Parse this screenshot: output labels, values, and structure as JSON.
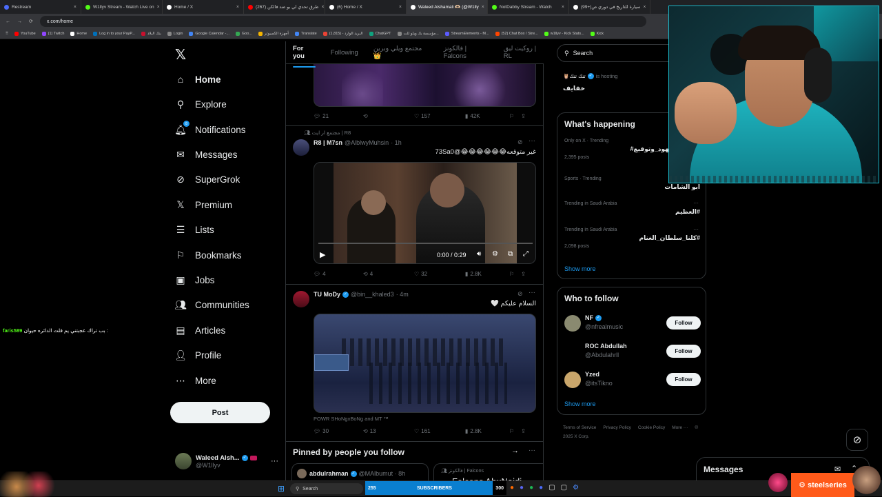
{
  "browser": {
    "tabs": [
      {
        "title": "Restream",
        "color": "#4b6bfb"
      },
      {
        "title": "W1llyv Stream - Watch Live on",
        "color": "#53fc18"
      },
      {
        "title": "Home / X",
        "color": "#ffffff"
      },
      {
        "title": "(267) طرق تحدي لي بو ضد فالكن",
        "color": "#ff0000"
      },
      {
        "title": "(6) Home / X",
        "color": "#ffffff"
      },
      {
        "title": "Waleed Alshamali 🫶🏻 (@W1lly",
        "color": "#ffffff"
      },
      {
        "title": "NotDabby Stream - Watch",
        "color": "#53fc18"
      },
      {
        "title": "(99+)سيارة للتاريخ في دوري ص",
        "color": "#ffffff"
      }
    ],
    "url": "x.com/home",
    "bookmarks": [
      {
        "label": "YouTube",
        "color": "#ff0000"
      },
      {
        "label": "(1) Twitch",
        "color": "#9146ff"
      },
      {
        "label": "Home",
        "color": "#ffffff"
      },
      {
        "label": "Log in to your PayP...",
        "color": "#0070ba"
      },
      {
        "label": "بنك البلاد",
        "color": "#c8102e"
      },
      {
        "label": "Login",
        "color": "#888888"
      },
      {
        "label": "Google Calendar -...",
        "color": "#4285f4"
      },
      {
        "label": "Goo...",
        "color": "#34a853"
      },
      {
        "label": "أجهزة الكمبيوتر",
        "color": "#f4b400"
      },
      {
        "label": "Translate",
        "color": "#4285f4"
      },
      {
        "label": "البريد الوارد - (1,815)",
        "color": "#ea4335"
      },
      {
        "label": "ChatGPT",
        "color": "#10a37f"
      },
      {
        "label": "مؤسسة بك ويلو للت...",
        "color": "#888888"
      },
      {
        "label": "StreamElements - M...",
        "color": "#5b5bff"
      },
      {
        "label": "(52) Chat Box / Stre...",
        "color": "#ff4500"
      },
      {
        "label": "w1llyv - Kick Stats...",
        "color": "#53fc18"
      },
      {
        "label": "Kick",
        "color": "#53fc18"
      }
    ]
  },
  "nav": {
    "items": [
      {
        "label": "Home",
        "icon": "home-icon",
        "glyph": "⌂"
      },
      {
        "label": "Explore",
        "icon": "search-icon",
        "glyph": "⚲"
      },
      {
        "label": "Notifications",
        "icon": "bell-icon",
        "glyph": "🔔︎",
        "badge": "8"
      },
      {
        "label": "Messages",
        "icon": "envelope-icon",
        "glyph": "✉"
      },
      {
        "label": "SuperGrok",
        "icon": "grok-icon",
        "glyph": "⊘"
      },
      {
        "label": "Premium",
        "icon": "x-logo-icon",
        "glyph": "𝕏"
      },
      {
        "label": "Lists",
        "icon": "list-icon",
        "glyph": "☰"
      },
      {
        "label": "Bookmarks",
        "icon": "bookmark-icon",
        "glyph": "⚐"
      },
      {
        "label": "Jobs",
        "icon": "briefcase-icon",
        "glyph": "▣"
      },
      {
        "label": "Communities",
        "icon": "people-icon",
        "glyph": "👥︎"
      },
      {
        "label": "Articles",
        "icon": "document-icon",
        "glyph": "▤"
      },
      {
        "label": "Profile",
        "icon": "person-icon",
        "glyph": "👤︎"
      },
      {
        "label": "More",
        "icon": "more-circle-icon",
        "glyph": "⋯"
      }
    ],
    "post_label": "Post",
    "account_name": "Waleed Alsh...",
    "account_handle": "@W1llyv"
  },
  "feed": {
    "tabs": [
      "For you",
      "Following",
      "مجتمع ويلي وبرين 👑",
      "فالكونز | Falcons",
      "روكيت ليق | RL"
    ],
    "tweet0": {
      "replies": "21",
      "retweets": "",
      "likes": "157",
      "views": "42K"
    },
    "tweet1": {
      "context": "مجتمع ار ايت | R8",
      "name": "R8 | M7sn",
      "handle": "@AlblwyMuhsin",
      "time": "· 1h",
      "text": "غير متوقعه😂😂😂😂😂😂@73Sa0",
      "video_time": "0:00 / 0:29",
      "replies": "4",
      "retweets": "4",
      "likes": "32",
      "views": "2.8K"
    },
    "tweet2": {
      "name": "TU MoDy",
      "handle": "@bin__khaled3",
      "time": "· 4m",
      "text": "السلام عليكم 🤍",
      "caption": "POWR SHoNgxBoNg and MT ™",
      "replies": "30",
      "retweets": "13",
      "likes": "161",
      "views": "2.8K"
    },
    "pinned_title": "Pinned by people you follow",
    "pinned1_name": "abdulrahman",
    "pinned1_handle": "@MAlbumut · 8h",
    "pinned2_context": "فالكونز | Falcons",
    "pinned2_name": "Falcons AbuNaidi"
  },
  "right": {
    "search_placeholder": "Search",
    "spaces_host": "🦉تنك تنك",
    "spaces_hosting": "is hosting",
    "spaces_title": "خفايف",
    "whats_happening": "What's happening",
    "trends": [
      {
        "meta": "Only on X · Trending",
        "name": "محتاجه_شهود_وتوقيع#",
        "posts": "2,395 posts"
      },
      {
        "meta": "Sports · Trending",
        "name": "ابو الشامات",
        "posts": ""
      },
      {
        "meta": "Trending in Saudi Arabia",
        "name": "#العظيم",
        "posts": ""
      },
      {
        "meta": "Trending in Saudi Arabia",
        "name": "#كلنا_سلطان_الغنام",
        "posts": "2,098 posts"
      }
    ],
    "show_more": "Show more",
    "who_to_follow": "Who to follow",
    "follows": [
      {
        "name": "NF",
        "handle": "@nfrealmusic",
        "verified": true,
        "color": "#8a8a70"
      },
      {
        "name": "ROC Abdullah",
        "handle": "@Abdulahrll",
        "verified": false,
        "color": "#000000"
      },
      {
        "name": "Yzed",
        "handle": "@itsTikno",
        "verified": false,
        "color": "#c9a66b"
      }
    ],
    "follow_label": "Follow",
    "show_more_2": "Show more",
    "footer": [
      "Terms of Service",
      "Privacy Policy",
      "Cookie Policy",
      "More ···",
      "© 2025 X Corp."
    ],
    "messages_label": "Messages"
  },
  "overlay": {
    "chat_user": "faris589",
    "chat_text": "بب تراك عجبتني يم قلت الدائره حيوان :",
    "subs_count": "255",
    "subs_label": "SUBSCRIBERS",
    "subs_goal": "300",
    "taskbar_search": "Search",
    "brand": "steelseries"
  }
}
